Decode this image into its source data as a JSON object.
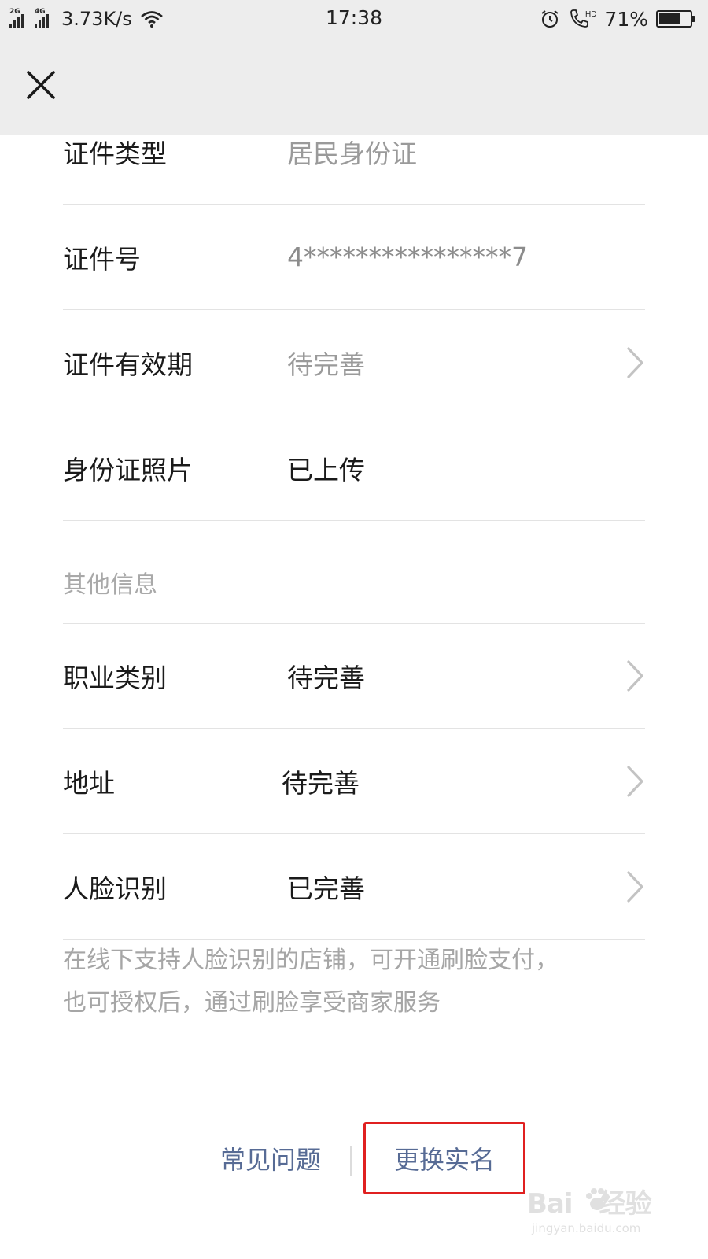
{
  "status_bar": {
    "sim1": "2G",
    "sim2": "4G",
    "net_speed": "3.73K/s",
    "time": "17:38",
    "battery_pct": "71%",
    "battery_level": 0.71,
    "icons": [
      "signal-icon",
      "signal-icon",
      "wifi-icon",
      "alarm-icon",
      "hd-call-icon",
      "battery-icon"
    ]
  },
  "nav": {
    "close_icon": "close-icon"
  },
  "id_info": {
    "rows": [
      {
        "label": "证件类型",
        "value": "居民身份证"
      },
      {
        "label": "证件号",
        "value": "4****************7"
      },
      {
        "label": "证件有效期",
        "value": "待完善"
      },
      {
        "label": "身份证照片",
        "value": "已上传"
      }
    ]
  },
  "other_info": {
    "title": "其他信息",
    "rows": [
      {
        "label": "职业类别",
        "value": "待完善"
      },
      {
        "label": "地址",
        "value": "待完善"
      },
      {
        "label": "人脸识别",
        "value": "已完善"
      }
    ],
    "desc_line1": "在线下支持人脸识别的店铺，可开通刷脸支付，",
    "desc_line2": "也可授权后，通过刷脸享受商家服务"
  },
  "footer": {
    "faq_label": "常见问题",
    "change_label": "更换实名"
  },
  "watermark": {
    "brand": "Bai",
    "brand2": "经验",
    "url": "jingyan.baidu.com"
  },
  "colors": {
    "link": "#576b95",
    "highlight": "#e02020",
    "muted": "#9a9a9a"
  }
}
